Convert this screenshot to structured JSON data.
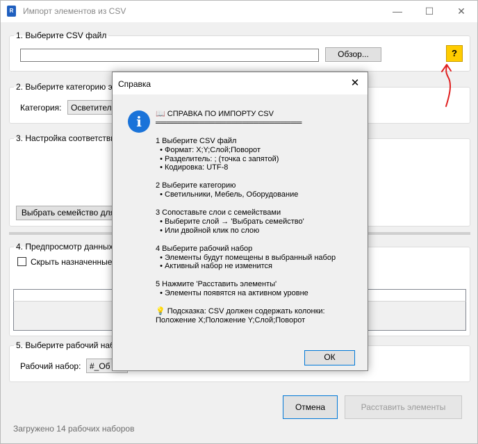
{
  "window": {
    "app_icon_text": "R",
    "title": "Импорт элементов из CSV",
    "controls": {
      "minimize": "—",
      "maximize": "☐",
      "close": "✕"
    }
  },
  "group1": {
    "legend": "1. Выберите CSV файл",
    "file_value": "",
    "browse_label": "Обзор...",
    "help_label": "?"
  },
  "group2": {
    "legend": "2. Выберите категорию эл",
    "category_label": "Категория:",
    "category_value": "Осветител"
  },
  "group3": {
    "legend": "3. Настройка соответстви",
    "select_family_label": "Выбрать семейство для"
  },
  "group4": {
    "legend": "4. Предпросмотр данных",
    "hide_assigned_label": "Скрыть назначенные"
  },
  "group5": {
    "legend": "5. Выберите рабочий наб",
    "workset_label": "Рабочий набор:",
    "workset_value": "#_Об"
  },
  "footer": {
    "cancel_label": "Отмена",
    "place_label": "Расставить элементы",
    "status": "Загружено 14 рабочих наборов"
  },
  "dialog": {
    "title": "Справка",
    "close": "✕",
    "info_icon": "i",
    "text": "📖 СПРАВКА ПО ИМПОРТУ CSV\n═══════════════════════════\n\n1 Выберите CSV файл\n  • Формат: X;Y;Слой;Поворот\n  • Разделитель: ; (точка с запятой)\n  • Кодировка: UTF-8\n\n2 Выберите категорию\n  • Светильники, Мебель, Оборудование\n\n3 Сопоставьте слои с семействами\n  • Выберите слой → 'Выбрать семейство'\n  • Или двойной клик по слою\n\n4 Выберите рабочий набор\n  • Элементы будут помещены в выбранный набор\n  • Активный набор не изменится\n\n5 Нажмите 'Расставить элементы'\n  • Элементы появятся на активном уровне\n\n💡 Подсказка: CSV должен содержать колонки:\nПоложение X;Положение Y;Слой;Поворот",
    "ok_label": "ОК"
  },
  "colors": {
    "accent": "#0078d7",
    "help_button": "#ffcc00",
    "annotation": "#e02020"
  }
}
